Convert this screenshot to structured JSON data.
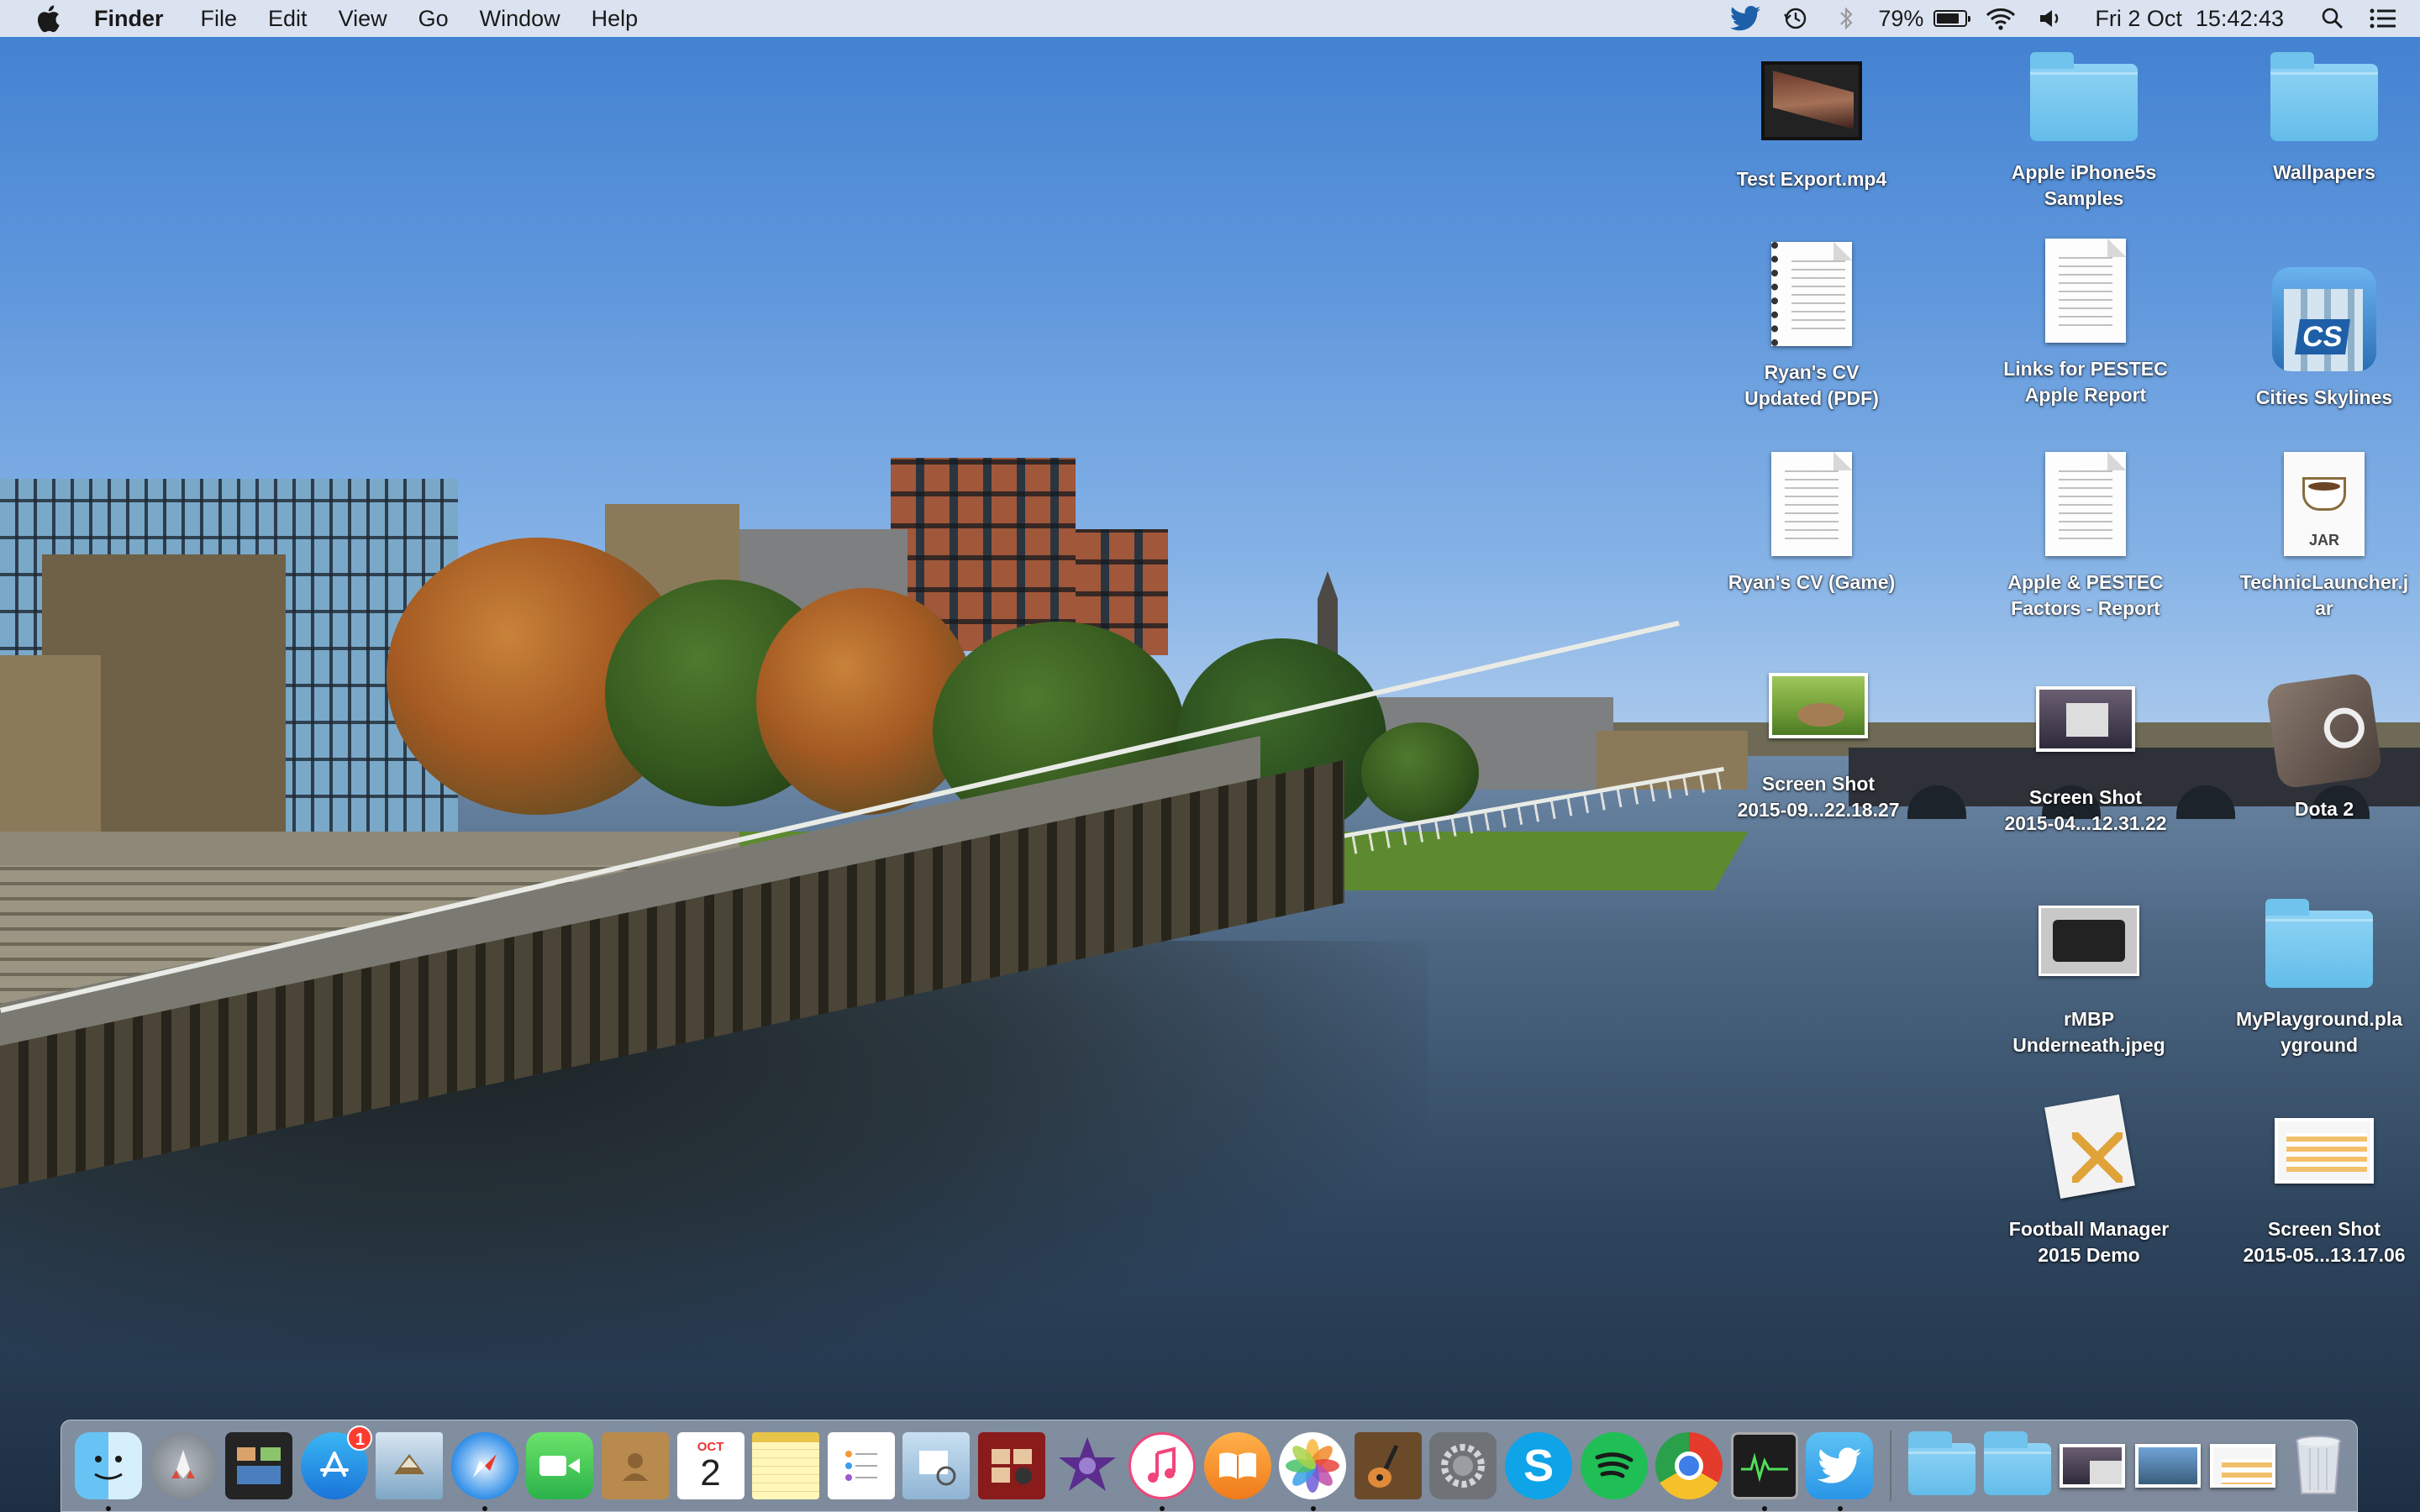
{
  "menubar": {
    "app_name": "Finder",
    "menus": [
      "File",
      "Edit",
      "View",
      "Go",
      "Window",
      "Help"
    ],
    "battery_percent": "79%",
    "battery_level": 0.79,
    "date": "Fri 2 Oct",
    "time": "15:42:43",
    "status_icons": [
      "twitter-icon",
      "time-machine-icon",
      "bluetooth-icon",
      "battery-icon",
      "wifi-icon",
      "volume-icon",
      "spotlight-icon",
      "notification-center-icon"
    ]
  },
  "desktop": {
    "icons": [
      {
        "label": "Test Export.mp4",
        "kind": "video"
      },
      {
        "label": "Apple iPhone5s\nSamples",
        "kind": "folder"
      },
      {
        "label": "Wallpapers",
        "kind": "folder"
      },
      {
        "label": "Ryan's CV\nUpdated (PDF)",
        "kind": "pdf"
      },
      {
        "label": "Links for PESTEC\nApple Report",
        "kind": "document"
      },
      {
        "label": "Cities Skylines",
        "kind": "app"
      },
      {
        "label": "Ryan's CV (Game)",
        "kind": "document"
      },
      {
        "label": "Apple & PESTEC\nFactors - Report",
        "kind": "document"
      },
      {
        "label": "TechnicLauncher.j\nar",
        "kind": "jar"
      },
      {
        "label": "Screen Shot\n2015-09...22.18.27",
        "kind": "screenshot"
      },
      {
        "label": "Screen Shot\n2015-04...12.31.22",
        "kind": "screenshot"
      },
      {
        "label": "Dota 2",
        "kind": "app"
      },
      {
        "label": "rMBP\nUnderneath.jpeg",
        "kind": "image"
      },
      {
        "label": "MyPlayground.pla\nyground",
        "kind": "folder"
      },
      {
        "label": "Football Manager\n2015 Demo",
        "kind": "installer"
      },
      {
        "label": "Screen Shot\n2015-05...13.17.06",
        "kind": "screenshot"
      }
    ]
  },
  "dock": {
    "calendar_month": "OCT",
    "calendar_day": "2",
    "app_store_badge": "1",
    "skype_letter": "S",
    "jar_tag": "JAR",
    "cities_tag": "CS",
    "apps": [
      "finder-icon",
      "launchpad-icon",
      "mission-control-icon",
      "app-store-icon",
      "mail-icon",
      "safari-icon",
      "facetime-icon",
      "contacts-icon",
      "calendar-icon",
      "notes-icon",
      "reminders-icon",
      "preview-icon",
      "photo-booth-icon",
      "imovie-icon",
      "itunes-icon",
      "ibooks-icon",
      "photos-icon",
      "garageband-icon",
      "system-preferences-icon",
      "skype-icon",
      "spotify-icon",
      "chrome-icon",
      "activity-monitor-icon",
      "twitter-icon"
    ],
    "stacks": [
      "applications-folder-icon",
      "downloads-folder-icon",
      "screenshot-stack-icon",
      "photo-stack-icon",
      "document-stack-icon",
      "trash-icon"
    ]
  }
}
